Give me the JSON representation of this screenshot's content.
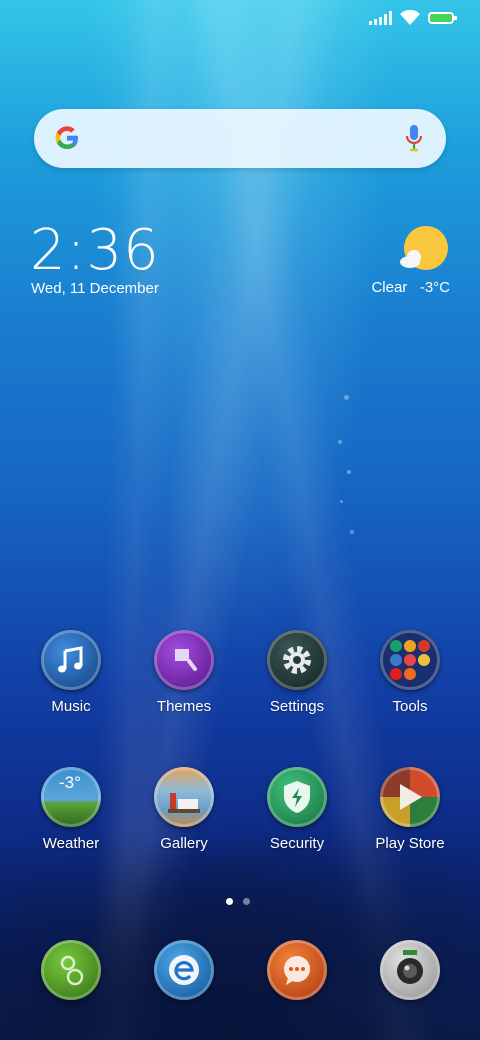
{
  "status_bar": {
    "signal_icon": "signal-icon",
    "wifi_icon": "wifi-icon",
    "battery_icon": "battery-charging-icon"
  },
  "search": {
    "logo": "google-g-icon",
    "mic": "mic-icon"
  },
  "clock": {
    "time": "2:36",
    "date": "Wed, 11 December"
  },
  "weather_widget": {
    "condition": "Clear",
    "temperature": "-3°C",
    "icon": "sun-cloud-icon"
  },
  "apps": {
    "row1": [
      {
        "label": "Music",
        "icon": "music-note-icon",
        "color": "#1c5fb8"
      },
      {
        "label": "Themes",
        "icon": "paintbrush-icon",
        "color": "#7a22b8"
      },
      {
        "label": "Settings",
        "icon": "gear-icon",
        "color": "#1e3b3a"
      },
      {
        "label": "Tools",
        "icon": "folder-icon",
        "color": "#1e3e80"
      }
    ],
    "row2": [
      {
        "label": "Weather",
        "icon": "weather-icon",
        "badge": "-3°",
        "color": "#2d7ab0"
      },
      {
        "label": "Gallery",
        "icon": "gallery-icon",
        "color": "#c87a3a"
      },
      {
        "label": "Security",
        "icon": "shield-icon",
        "color": "#2e9a60"
      },
      {
        "label": "Play Store",
        "icon": "play-store-icon",
        "color": "#b55a3a"
      }
    ]
  },
  "pager": {
    "pages": 2,
    "active": 1
  },
  "dock": [
    {
      "name": "phone",
      "icon": "phone-icon",
      "color": "#5aa22a"
    },
    {
      "name": "browser",
      "icon": "browser-e-icon",
      "color": "#2a8ad0"
    },
    {
      "name": "messages",
      "icon": "message-bubble-icon",
      "color": "#e0561e"
    },
    {
      "name": "camera",
      "icon": "camera-icon",
      "color": "#3a3a3a"
    }
  ]
}
